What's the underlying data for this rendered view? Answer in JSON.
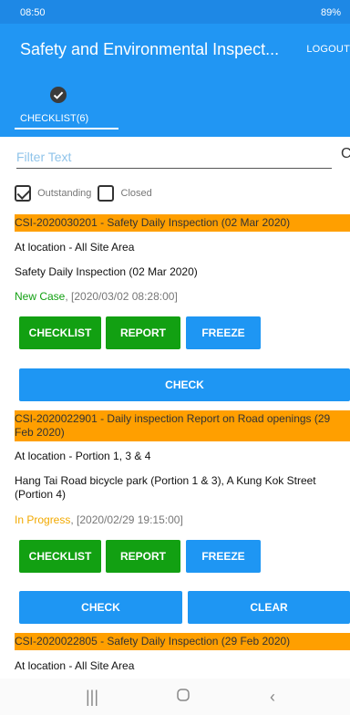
{
  "status_bar": {
    "time": "08:50",
    "right": "89%"
  },
  "app_bar": {
    "title": "Safety and Environmental Inspect...",
    "logout": "LOGOUT"
  },
  "tabs": [
    {
      "label": "CHECKLIST(6)",
      "icon": "check-circle-icon"
    }
  ],
  "filter": {
    "placeholder": "Filter Text"
  },
  "filters": {
    "outstanding": {
      "label": "Outstanding",
      "checked": true
    },
    "closed": {
      "label": "Closed",
      "checked": false
    }
  },
  "cards": [
    {
      "header": "CSI-2020030201 - Safety Daily Inspection (02 Mar 2020)",
      "location": "At location - All Site Area",
      "description": "Safety Daily Inspection (02 Mar 2020)",
      "status": "New Case",
      "timestamp": ", [2020/03/02 08:28:00]",
      "buttons": [
        "CHECKLIST",
        "REPORT",
        "FREEZE"
      ],
      "actions": [
        "CHECK"
      ]
    },
    {
      "header": "CSI-2020022901 - Daily inspection Report on Road openings (29 Feb 2020)",
      "location": "At location - Portion 1, 3 & 4",
      "description": "Hang Tai Road bicycle park (Portion 1 & 3), A Kung Kok Street (Portion 4)",
      "status": "In Progress",
      "timestamp": ", [2020/02/29 19:15:00]",
      "buttons": [
        "CHECKLIST",
        "REPORT",
        "FREEZE"
      ],
      "actions": [
        "CHECK",
        "CLEAR"
      ]
    },
    {
      "header": "CSI-2020022805 - Safety Daily Inspection (29 Feb 2020)",
      "location": "At location - All Site Area"
    }
  ],
  "colors": {
    "primary": "#2196f3",
    "header_orange": "#ff9f00",
    "button_green": "#12a012",
    "button_blue": "#1e96f3",
    "status_new": "#12a012",
    "status_in_progress": "#f2a900"
  },
  "nav_bar": {
    "icons": [
      "recent-apps-icon",
      "home-icon",
      "back-icon"
    ]
  }
}
